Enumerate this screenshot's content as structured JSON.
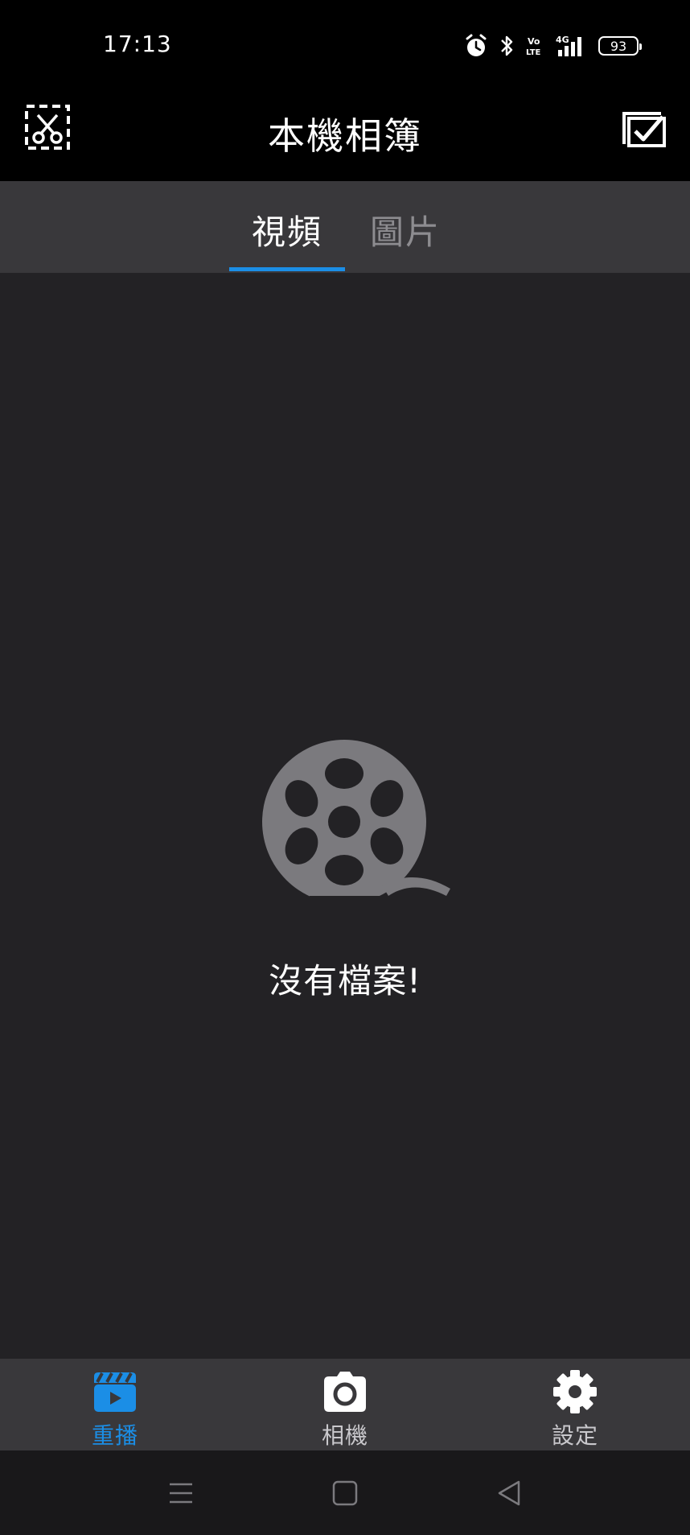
{
  "status_bar": {
    "time": "17:13",
    "network": "4G",
    "volte": "Vo LTE",
    "battery": "93",
    "icons": [
      "alarm-icon",
      "bluetooth-icon",
      "volte-icon",
      "signal-icon",
      "battery-icon"
    ]
  },
  "header": {
    "title": "本機相簿",
    "left_icon": "scissors-select-icon",
    "right_icon": "select-all-checkbox-icon"
  },
  "tabs": [
    {
      "label": "視頻",
      "active": true
    },
    {
      "label": "圖片",
      "active": false
    }
  ],
  "empty_state": {
    "icon": "film-reel-icon",
    "message": "沒有檔案!"
  },
  "bottom_nav": [
    {
      "label": "重播",
      "icon": "clapperboard-icon",
      "active": true
    },
    {
      "label": "相機",
      "icon": "camera-icon",
      "active": false
    },
    {
      "label": "設定",
      "icon": "gear-icon",
      "active": false
    }
  ],
  "colors": {
    "accent": "#1b8ee6",
    "background": "#232225",
    "bar": "#39383b",
    "icon_gray": "#7b7a7e"
  }
}
